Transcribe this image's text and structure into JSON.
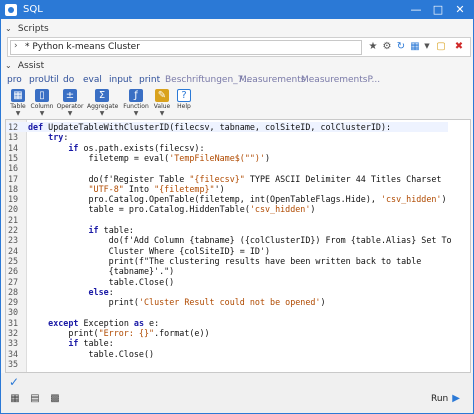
{
  "window": {
    "title": "SQL"
  },
  "scripts": {
    "header": "Scripts",
    "selected": "* Python k-means Cluster",
    "toolbar_icons": [
      "star-icon",
      "gear-icon",
      "refresh-icon",
      "save-icon",
      "dropdown-icon",
      "folder-icon",
      "close-icon"
    ]
  },
  "assist": {
    "header": "Assist",
    "tabs": [
      "pro",
      "proUtil",
      "do",
      "eval",
      "input",
      "print",
      "Beschriftungen_7...",
      "Measurements",
      "MeasurementsP..."
    ],
    "tools": [
      {
        "label": "Table",
        "icon": "table-icon",
        "color": "#3a6fc4"
      },
      {
        "label": "Column",
        "icon": "column-icon",
        "color": "#3a6fc4"
      },
      {
        "label": "Operator",
        "icon": "operator-icon",
        "color": "#3a6fc4"
      },
      {
        "label": "Aggregate",
        "icon": "sigma-icon",
        "color": "#3a6fc4"
      },
      {
        "label": "Function",
        "icon": "function-icon",
        "color": "#3a6fc4"
      },
      {
        "label": "Value",
        "icon": "value-icon",
        "color": "#3a6fc4"
      },
      {
        "label": "Help",
        "icon": "help-icon",
        "color": "#3a6fc4"
      }
    ]
  },
  "editor": {
    "lines": [
      {
        "n": "12",
        "t": "def UpdateTableWithClusterID(filecsv, tabname, colSiteID, colClusterID):"
      },
      {
        "n": "13",
        "t": "    try:"
      },
      {
        "n": "14",
        "t": "        if os.path.exists(filecsv):"
      },
      {
        "n": "15",
        "t": "            filetemp = eval('TempFileName$(\"\")')"
      },
      {
        "n": "16",
        "t": ""
      },
      {
        "n": "17",
        "t": "            do(f'Register Table \"{filecsv}\" TYPE ASCII Delimiter 44 Titles Charset"
      },
      {
        "n": "18",
        "t": "            \"UTF-8\" Into \"{filetemp}\"')"
      },
      {
        "n": "19",
        "t": "            pro.Catalog.OpenTable(filetemp, int(OpenTableFlags.Hide), 'csv_hidden')"
      },
      {
        "n": "20",
        "t": "            table = pro.Catalog.HiddenTable('csv_hidden')"
      },
      {
        "n": "21",
        "t": ""
      },
      {
        "n": "22",
        "t": "            if table:"
      },
      {
        "n": "23",
        "t": "                do(f'Add Column {tabname} ({colClusterID}) From {table.Alias} Set To"
      },
      {
        "n": "24",
        "t": "                Cluster Where {colSiteID} = ID')"
      },
      {
        "n": "25",
        "t": "                print(f\"The clustering results have been written back to table"
      },
      {
        "n": "26",
        "t": "                {tabname}'.\")"
      },
      {
        "n": "27",
        "t": "                table.Close()"
      },
      {
        "n": "28",
        "t": "            else:"
      },
      {
        "n": "29",
        "t": "                print('Cluster Result could not be opened')"
      },
      {
        "n": "30",
        "t": ""
      },
      {
        "n": "31",
        "t": "    except Exception as e:"
      },
      {
        "n": "32",
        "t": "        print(\"Error: {}\".format(e))"
      },
      {
        "n": "33",
        "t": "        if table:"
      },
      {
        "n": "34",
        "t": "            table.Close()"
      },
      {
        "n": "35",
        "t": ""
      }
    ]
  },
  "footer": {
    "run_label": "Run"
  }
}
